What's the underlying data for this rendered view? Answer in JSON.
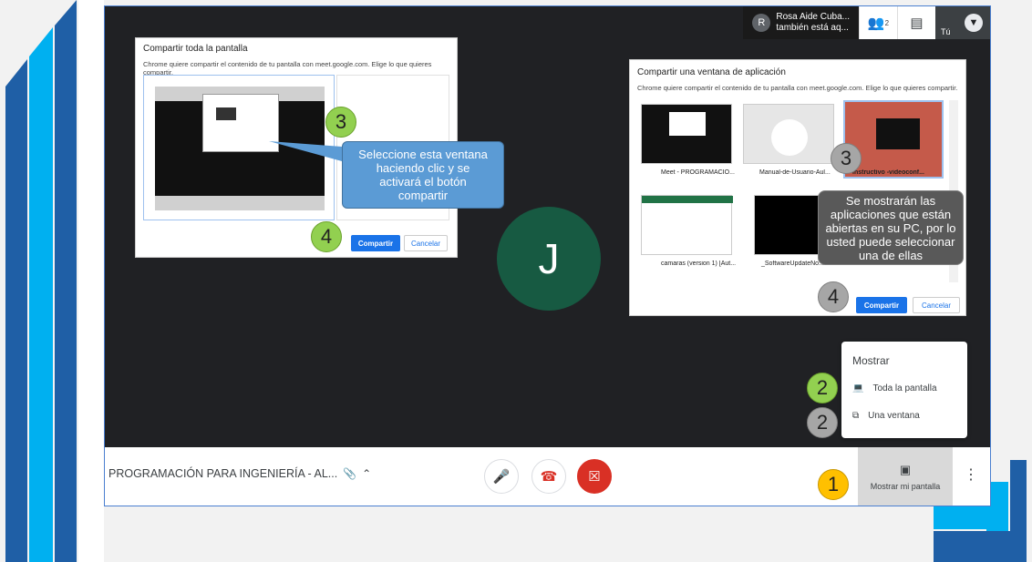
{
  "participant": {
    "avatar_letter": "R",
    "line1": "Rosa Aide Cuba...",
    "line2": "también está aq..."
  },
  "toolbar": {
    "people_count": "2",
    "self_label": "Tú"
  },
  "dialog_full": {
    "title": "Compartir toda la pantalla",
    "subtitle": "Chrome quiere compartir el contenido de tu pantalla con meet.google.com. Elige lo que quieres compartir.",
    "share_label": "Compartir",
    "cancel_label": "Cancelar"
  },
  "dialog_window": {
    "title": "Compartir una ventana de aplicación",
    "subtitle": "Chrome quiere compartir el contenido de tu pantalla con meet.google.com. Elige lo que quieres compartir.",
    "share_label": "Compartir",
    "cancel_label": "Cancelar",
    "windows": [
      {
        "label": "Meet - PROGRAMACIÓ..."
      },
      {
        "label": "Manual-de-Usuario-Aul..."
      },
      {
        "label": "Instructivo -videoconf..."
      },
      {
        "label": "camaras (version 1) [Aut..."
      },
      {
        "label": "_SoftwareUpdateNo..."
      }
    ]
  },
  "callouts": {
    "select_window": "Seleccione esta ventana haciendo clic y se  activará el botón compartir",
    "apps_info": "Se mostrarán las aplicaciones que están abiertas en su PC, por lo usted puede seleccionar una de ellas"
  },
  "step_numbers": {
    "one": "1",
    "two": "2",
    "three": "3",
    "four": "4"
  },
  "self_tile": {
    "letter": "J"
  },
  "present_menu": {
    "title": "Mostrar",
    "items": [
      {
        "label": "Toda la pantalla",
        "icon": "laptop-icon"
      },
      {
        "label": "Una ventana",
        "icon": "window-icon"
      }
    ]
  },
  "bottom_bar": {
    "meeting_title": "PROGRAMACIÓN PARA INGENIERÍA - AL...",
    "present_label": "Mostrar mi pantalla"
  },
  "colors": {
    "stage": "#202124",
    "avatar_j": "#175a42",
    "callout_blue": "#5b9bd5",
    "callout_gray": "#595959",
    "green_step": "#92d050",
    "gray_step": "#a6a6a6",
    "yellow_step": "#ffc000",
    "hangup_red": "#d93025"
  }
}
